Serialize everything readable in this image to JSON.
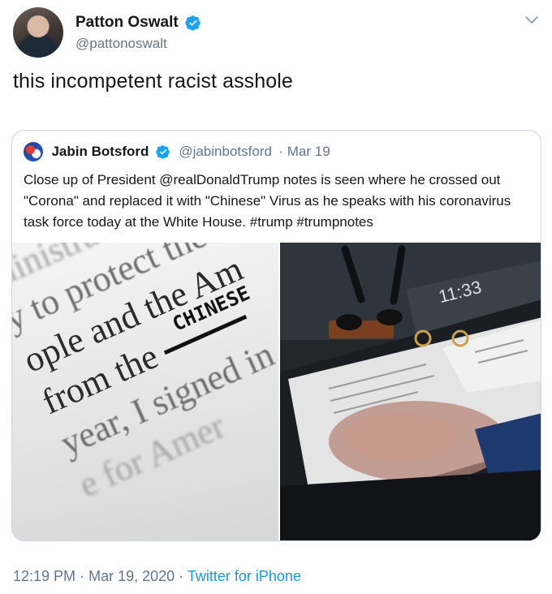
{
  "author": {
    "display_name": "Patton Oswalt",
    "handle": "@pattonoswalt"
  },
  "tweet": {
    "text": "this incompetent racist asshole"
  },
  "quoted": {
    "display_name": "Jabin Botsford",
    "handle": "@jabinbotsford",
    "date": "· Mar 19",
    "body": "Close up of President @realDonaldTrump notes is seen where he crossed out \"Corona\" and replaced it with \"Chinese\" Virus as he speaks with his coronavirus task force today at the White House. #trump #trumpnotes",
    "photo_left_lines": [
      "ministration",
      "y to protect the",
      "ople and the Am",
      "from the",
      "year, I signed in",
      "e for Amer"
    ],
    "photo_left_handwritten": "CHINESE",
    "photo_right_clock": "11:33"
  },
  "footer": {
    "time": "12:19 PM",
    "date": "Mar 19, 2020",
    "separator": "·",
    "source": "Twitter for iPhone"
  },
  "colors": {
    "verified": "#1da1f2",
    "link": "#1b95e0",
    "secondary_text": "#657786",
    "border": "#ccd6dd"
  }
}
